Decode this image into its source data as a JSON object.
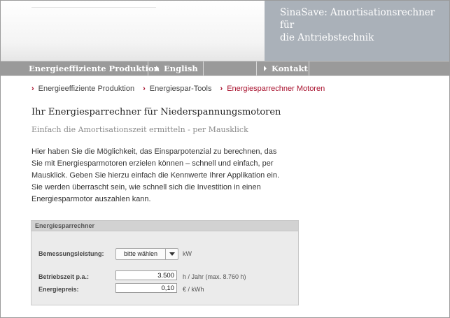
{
  "header": {
    "title_line1": "SinaSave: Amortisationsrechner für",
    "title_line2": "die Antriebstechnik"
  },
  "nav": {
    "items": [
      {
        "label": "Energieeffiziente Produktion"
      },
      {
        "label": "English"
      },
      {
        "label": "Kontakt"
      }
    ]
  },
  "breadcrumb": {
    "items": [
      {
        "label": "Energieeffiziente Produktion"
      },
      {
        "label": "Energiespar-Tools"
      },
      {
        "label": "Energiesparrechner Motoren"
      }
    ]
  },
  "main": {
    "title": "Ihr Energiesparrechner für Niederspannungsmotoren",
    "subtitle": "Einfach die Amortisationszeit ermitteln - per Mausklick",
    "intro_lines": [
      "Hier haben Sie die Möglichkeit, das Einsparpotenzial zu berechnen, das",
      "Sie mit Energiesparmotoren erzielen können – schnell und einfach, per",
      "Mausklick. Geben Sie hierzu einfach die Kennwerte Ihrer Applikation ein.",
      "Sie werden überrascht sein, wie schnell sich die Investition in einen",
      "Energiesparmotor auszahlen kann."
    ]
  },
  "calculator": {
    "heading": "Energiesparrechner",
    "rated_power": {
      "label": "Bemessungsleistung:",
      "selected": "bitte wählen",
      "unit": "kW"
    },
    "operating_time": {
      "label": "Betriebszeit p.a.:",
      "value": "3.500",
      "unit": "h / Jahr (max. 8.760 h)"
    },
    "energy_price": {
      "label": "Energiepreis:",
      "value": "0,10",
      "unit": "€ / kWh"
    }
  },
  "colors": {
    "accent": "#a8102c",
    "nav_bg": "#9a9a9a",
    "header_right_bg": "#aab1b9"
  }
}
